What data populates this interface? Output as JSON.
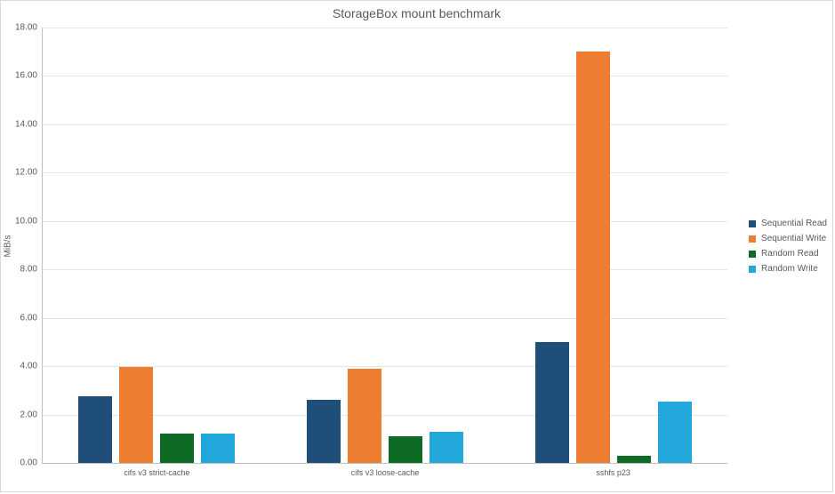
{
  "chart_data": {
    "type": "bar",
    "title": "StorageBox mount benchmark",
    "xlabel": "",
    "ylabel": "MiB/s",
    "ylim": [
      0,
      18
    ],
    "ytick_step": 2,
    "categories": [
      "cifs v3 strict-cache",
      "cifs v3 loose-cache",
      "sshfs p23"
    ],
    "series": [
      {
        "name": "Sequential Read",
        "color": "#1f4e79",
        "values": [
          2.75,
          2.6,
          5.0
        ]
      },
      {
        "name": "Sequential Write",
        "color": "#ed7d31",
        "values": [
          3.95,
          3.9,
          17.0
        ]
      },
      {
        "name": "Random Read",
        "color": "#0e6b26",
        "values": [
          1.2,
          1.1,
          0.3
        ]
      },
      {
        "name": "Random Write",
        "color": "#22a7db",
        "values": [
          1.2,
          1.3,
          2.55
        ]
      }
    ]
  }
}
